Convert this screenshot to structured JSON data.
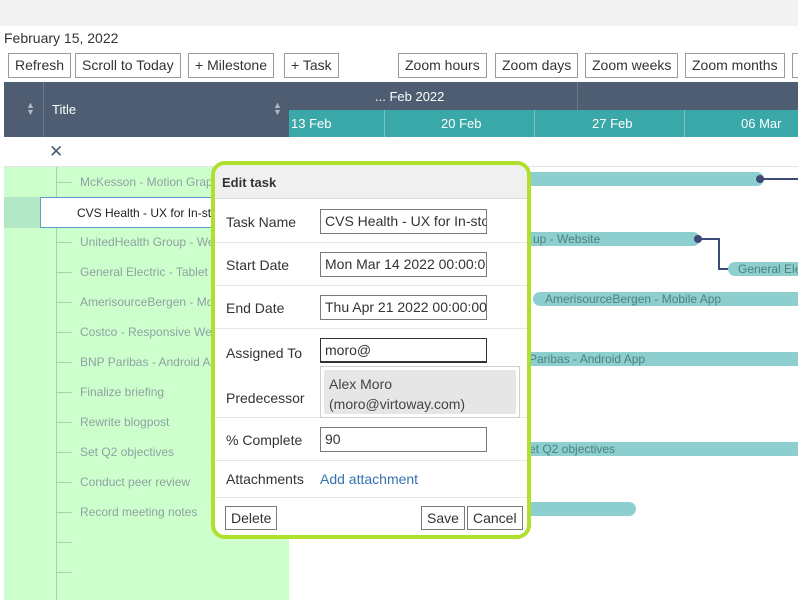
{
  "current_date": "February 15, 2022",
  "toolbar": {
    "refresh": "Refresh",
    "scroll_today": "Scroll to Today",
    "add_milestone": "+ Milestone",
    "add_task": "+ Task",
    "zoom_hours": "Zoom hours",
    "zoom_days": "Zoom days",
    "zoom_weeks": "Zoom weeks",
    "zoom_months": "Zoom months"
  },
  "grid": {
    "title_header": "Title",
    "sort_icon": "sort-arrows-icon",
    "filter_clear_icon": "close-icon",
    "rows": [
      "McKesson - Motion Graphics",
      "CVS Health - UX for In-store",
      "UnitedHealth Group - Website",
      "General Electric - Tablet App",
      "AmerisourceBergen - Mobile App",
      "Costco - Responsive Website",
      "BNP Paribas - Android App",
      "Finalize briefing",
      "Rewrite blogpost",
      "Set Q2 objectives",
      "Conduct peer review",
      "Record meeting notes"
    ],
    "selected_index": 1
  },
  "timeline": {
    "month": "... Feb 2022",
    "weeks": [
      "13 Feb",
      "20 Feb",
      "27 Feb",
      "06 Mar"
    ]
  },
  "bars": {
    "unitedhealth": "up - Website",
    "general_electric": "General Ele",
    "amerisource": "AmerisourceBergen - Mobile App",
    "bnp": "Paribas - Android App",
    "set_q2": "et Q2 objectives"
  },
  "dialog": {
    "title": "Edit task",
    "task_name_label": "Task Name",
    "task_name_value": "CVS Health - UX for In-store",
    "start_date_label": "Start Date",
    "start_date_value": "Mon Mar 14 2022 00:00:00",
    "end_date_label": "End Date",
    "end_date_value": "Thu Apr 21 2022 00:00:00",
    "assigned_label": "Assigned To",
    "assigned_value": "moro@",
    "suggestion_name": "Alex Moro",
    "suggestion_email": "(moro@virtoway.com)",
    "predecessor_label": "Predecessor",
    "complete_label": "% Complete",
    "complete_value": "90",
    "attachments_label": "Attachments",
    "add_attachment": "Add attachment",
    "delete": "Delete",
    "save": "Save",
    "cancel": "Cancel"
  },
  "colors": {
    "highlight_border": "#aee02c",
    "list_bg": "#ccffcc",
    "header_bg": "#4e5d72",
    "timeline_bg": "#3aa8a8",
    "bar": "#8dcfcf",
    "link": "#3572b0"
  }
}
